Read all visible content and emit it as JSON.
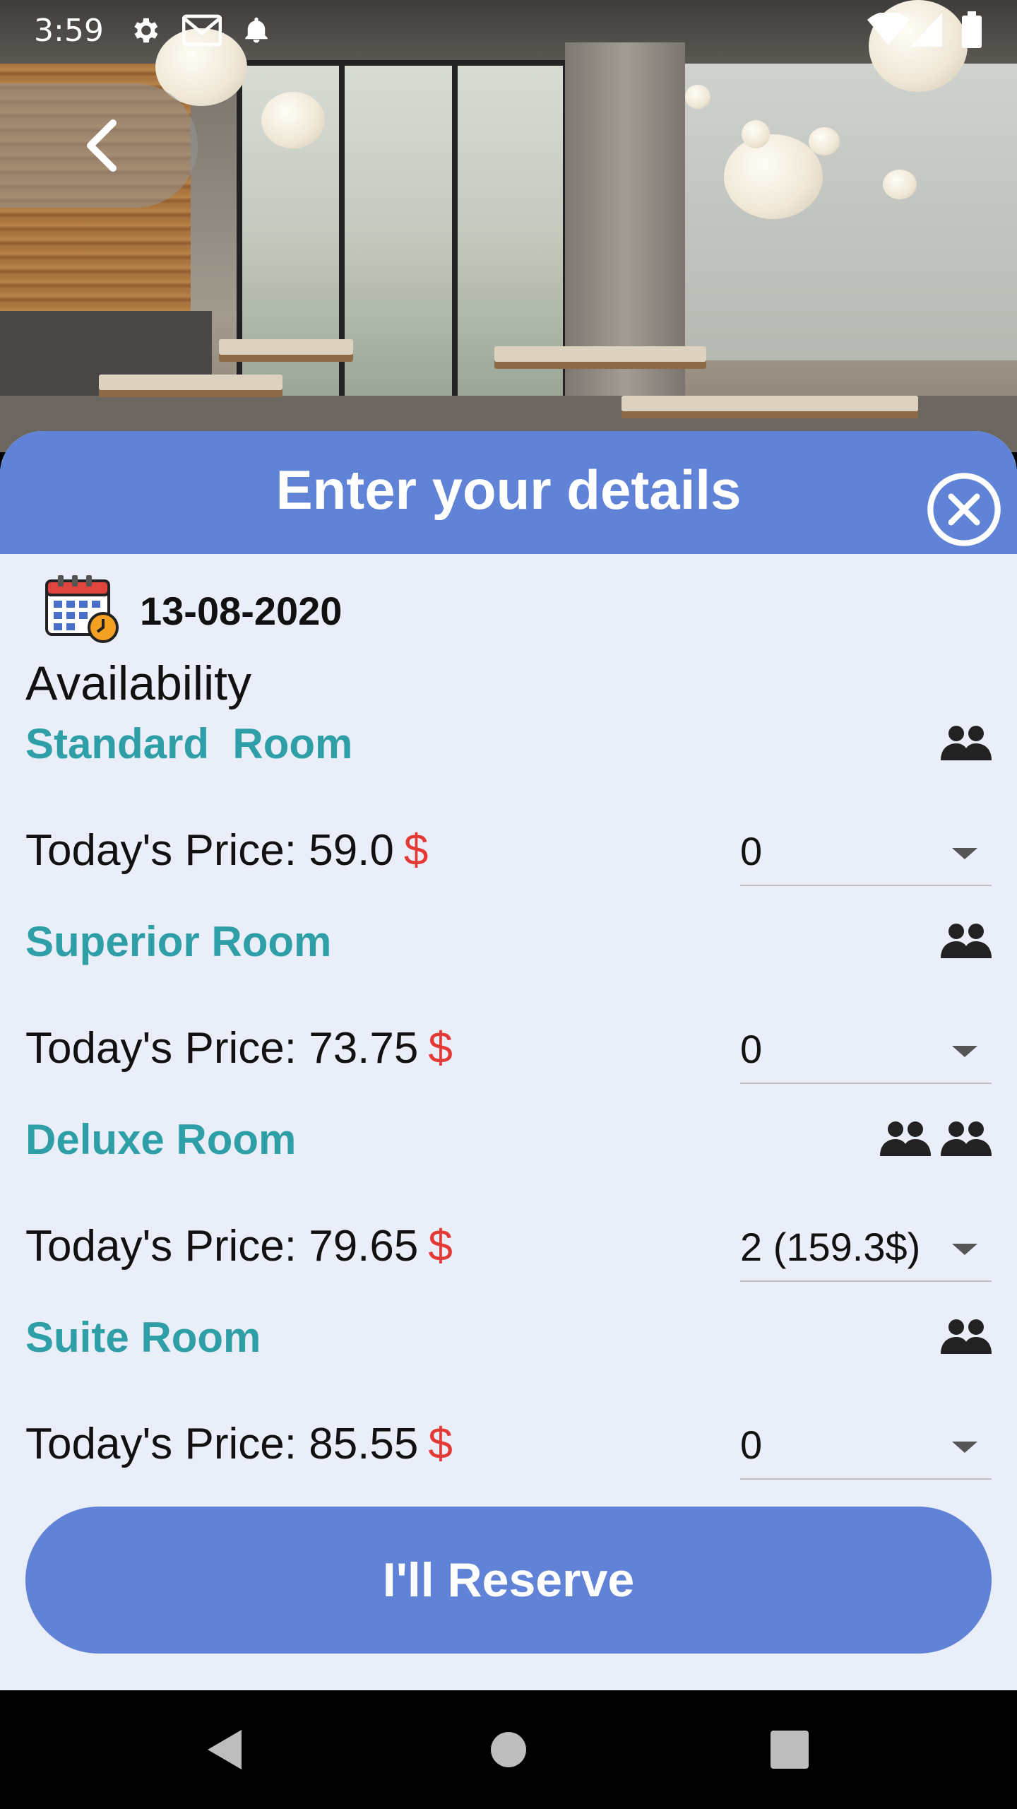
{
  "status_bar": {
    "time": "3:59",
    "icons": [
      "settings-icon",
      "gmail-icon",
      "notification-bell-icon",
      "wifi-icon",
      "signal-icon",
      "battery-icon"
    ]
  },
  "header_photo": {
    "description_icon": "restaurant-photo"
  },
  "back_button": {
    "icon": "chevron-left-icon"
  },
  "sheet": {
    "title": "Enter your details",
    "close_icon": "close-circle-icon",
    "date": "13-08-2020",
    "date_icon": "calendar-clock-icon",
    "availability_label": "Availability",
    "rooms": [
      {
        "name": "Standard  Room",
        "price_label": "Today's Price: 59.0",
        "currency": "$",
        "selected": "0",
        "occupancy_icons": 1
      },
      {
        "name": "Superior Room",
        "price_label": "Today's Price: 73.75",
        "currency": "$",
        "selected": "0",
        "occupancy_icons": 1
      },
      {
        "name": "Deluxe Room",
        "price_label": "Today's Price: 79.65",
        "currency": "$",
        "selected": "2  (159.3$)",
        "occupancy_icons": 2
      },
      {
        "name": "Suite Room",
        "price_label": "Today's Price: 85.55",
        "currency": "$",
        "selected": "0",
        "occupancy_icons": 1
      }
    ],
    "reserve_label": "I'll Reserve"
  },
  "nav_bar": {
    "icons": [
      "back-triangle-icon",
      "home-circle-icon",
      "recents-square-icon"
    ]
  },
  "colors": {
    "accent": "#6183d7",
    "room_name": "#2e9fa6",
    "currency": "#e53935",
    "sheet_background": "#e9eef8"
  }
}
